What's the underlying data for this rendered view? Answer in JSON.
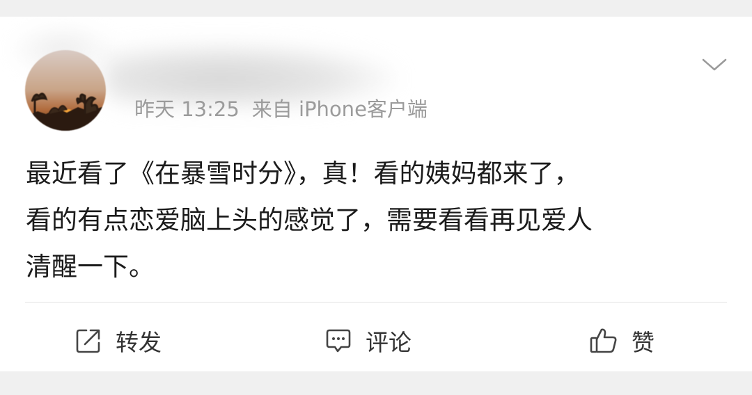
{
  "post": {
    "timestamp": "昨天 13:25",
    "source": "来自 iPhone客户端",
    "text_lines": [
      "最近看了《在暴雪时分》，真！看的姨妈都来了，",
      "看的有点恋爱脑上头的感觉了，需要看看再见爱人",
      "清醒一下。"
    ]
  },
  "actions": {
    "repost_label": "转发",
    "comment_label": "评论",
    "like_label": "赞"
  },
  "icons": {
    "menu": "chevron-down-icon",
    "repost": "repost-icon",
    "comment": "comment-icon",
    "like": "thumbs-up-icon"
  },
  "colors": {
    "background": "#f0f0f0",
    "card": "#ffffff",
    "meta_text": "#9b9b9b",
    "body_text": "#1b1b1b"
  }
}
